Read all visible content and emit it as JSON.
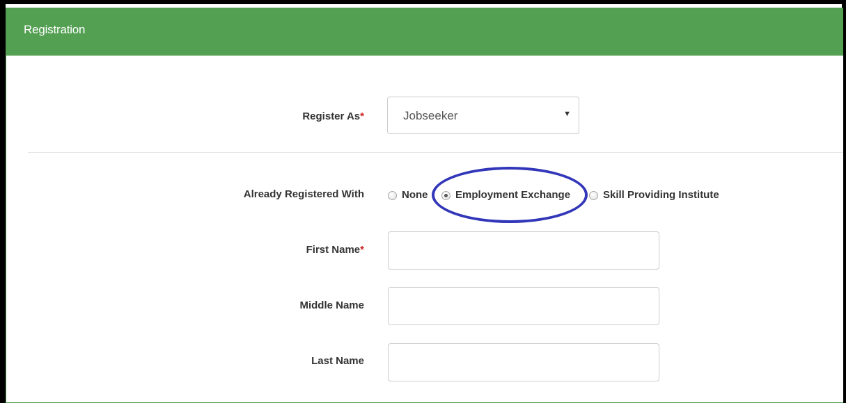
{
  "panel": {
    "title": "Registration"
  },
  "form": {
    "register_as": {
      "label": "Register As",
      "required_mark": "*",
      "selected": "Jobseeker"
    },
    "already_registered": {
      "label": "Already Registered With",
      "options": [
        {
          "label": "None",
          "checked": false
        },
        {
          "label": "Employment Exchange",
          "checked": true
        },
        {
          "label": "Skill Providing Institute",
          "checked": false
        }
      ]
    },
    "first_name": {
      "label": "First Name",
      "required_mark": "*",
      "value": ""
    },
    "middle_name": {
      "label": "Middle Name",
      "value": ""
    },
    "last_name": {
      "label": "Last Name",
      "value": ""
    }
  },
  "colors": {
    "header_bg": "#53a052",
    "highlight_oval": "#3236b8",
    "required": "#cc2222"
  },
  "icons": {
    "select_arrow": "caret-down-icon"
  }
}
